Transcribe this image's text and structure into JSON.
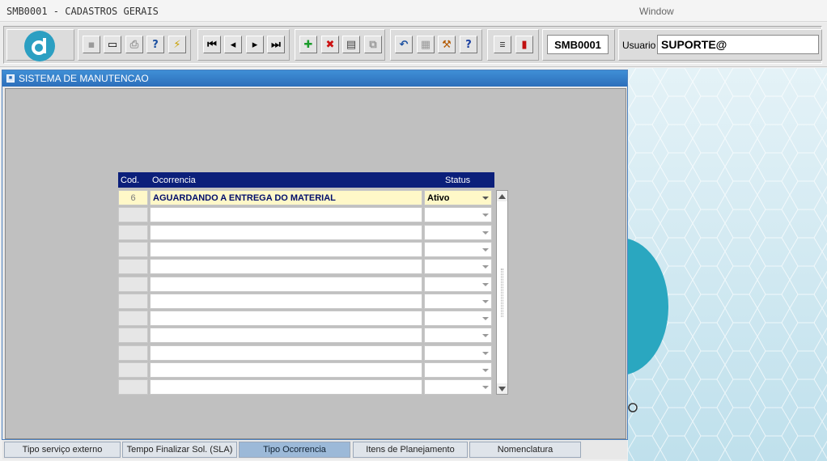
{
  "menubar": {
    "app_title": "SMB0001 - CADASTROS GERAIS",
    "window_menu": "Window"
  },
  "toolbar": {
    "form_code": "SMB0001",
    "user_label": "Usuario",
    "user_value": "SUPORTE@"
  },
  "inner_window": {
    "title": "SISTEMA DE MANUTENCAO"
  },
  "grid": {
    "columns": {
      "cod": "Cod.",
      "ocorrencia": "Ocorrencia",
      "status": "Status"
    },
    "rows": [
      {
        "cod": "6",
        "ocorrencia": "AGUARDANDO A ENTREGA DO MATERIAL",
        "status": "Ativo"
      },
      {
        "cod": "",
        "ocorrencia": "",
        "status": ""
      },
      {
        "cod": "",
        "ocorrencia": "",
        "status": ""
      },
      {
        "cod": "",
        "ocorrencia": "",
        "status": ""
      },
      {
        "cod": "",
        "ocorrencia": "",
        "status": ""
      },
      {
        "cod": "",
        "ocorrencia": "",
        "status": ""
      },
      {
        "cod": "",
        "ocorrencia": "",
        "status": ""
      },
      {
        "cod": "",
        "ocorrencia": "",
        "status": ""
      },
      {
        "cod": "",
        "ocorrencia": "",
        "status": ""
      },
      {
        "cod": "",
        "ocorrencia": "",
        "status": ""
      },
      {
        "cod": "",
        "ocorrencia": "",
        "status": ""
      },
      {
        "cod": "",
        "ocorrencia": "",
        "status": ""
      }
    ]
  },
  "tabs": [
    {
      "label": "Tipo serviço externo",
      "active": false
    },
    {
      "label": "Tempo Finalizar Sol. (SLA)",
      "active": false
    },
    {
      "label": "Tipo Ocorrencia",
      "active": true
    },
    {
      "label": "Itens de Planejamento",
      "active": false
    },
    {
      "label": "Nomenclatura",
      "active": false
    }
  ],
  "colors": {
    "grid_header": "#0b1f7a",
    "selected_row": "#fff8c8",
    "title_bar": "#2d6fbb",
    "active_tab": "#9cb9d8"
  }
}
